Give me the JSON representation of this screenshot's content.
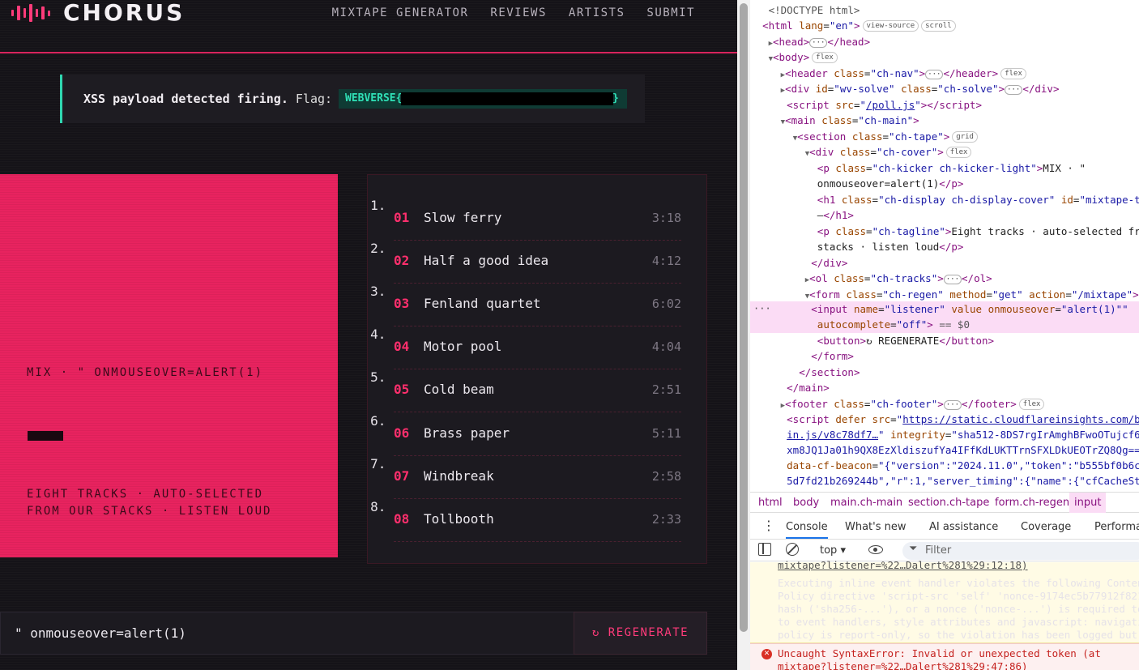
{
  "nav": {
    "logo": "CHORUS",
    "links": [
      "MIXTAPE GENERATOR",
      "REVIEWS",
      "ARTISTS",
      "SUBMIT"
    ]
  },
  "solve": {
    "message": "XSS payload detected firing.",
    "flag_label": "Flag:",
    "flag_prefix": "WEBVERSE{",
    "flag_suffix": "}"
  },
  "cover": {
    "kicker": "MIX · \" ONMOUSEOVER=ALERT(1)",
    "tagline": "EIGHT TRACKS · AUTO-SELECTED FROM OUR STACKS · LISTEN LOUD"
  },
  "tracks": [
    {
      "num": "01",
      "title": "Slow ferry",
      "duration": "3:18"
    },
    {
      "num": "02",
      "title": "Half a good idea",
      "duration": "4:12"
    },
    {
      "num": "03",
      "title": "Fenland quartet",
      "duration": "6:02"
    },
    {
      "num": "04",
      "title": "Motor pool",
      "duration": "4:04"
    },
    {
      "num": "05",
      "title": "Cold beam",
      "duration": "2:51"
    },
    {
      "num": "06",
      "title": "Brass paper",
      "duration": "5:11"
    },
    {
      "num": "07",
      "title": "Windbreak",
      "duration": "2:58"
    },
    {
      "num": "08",
      "title": "Tollbooth",
      "duration": "2:33"
    }
  ],
  "regen": {
    "input_value": "\" onmouseover=alert(1)",
    "button_label": "↻ REGENERATE"
  },
  "devtools": {
    "breadcrumbs": [
      "html",
      "body",
      "main.ch-main",
      "section.ch-tape",
      "form.ch-regen",
      "input"
    ],
    "tabs": [
      "Console",
      "What's new",
      "AI assistance",
      "Coverage",
      "Performa"
    ],
    "context": "top",
    "filter_placeholder": "Filter",
    "console": {
      "warn_link_top": "mixtape?listener=%22…Dalert%281%29:12:18)",
      "warn_lines": [
        "Executing inline event handler violates the following Content",
        "Policy directive 'script-src 'self' 'nonce-9174ec5b77912f821",
        "hash ('sha256-...'), or a nonce ('nonce-...') is required to",
        "to event handlers, style attributes and javascript: navigati",
        "policy is report-only, so the violation has been logged but"
      ],
      "error_text": "Uncaught SyntaxError: Invalid or unexpected token (at",
      "error_link": "mixtape?listener=%22…Dalert%281%29:47:86)"
    }
  }
}
